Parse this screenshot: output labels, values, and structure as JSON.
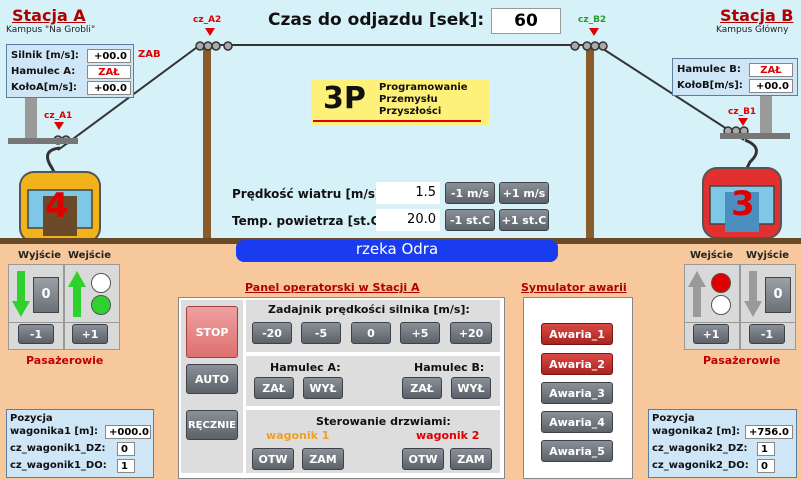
{
  "header": {
    "countdown_label": "Czas do odjazdu [sek]:",
    "countdown_value": "60"
  },
  "station_a": {
    "title": "Stacja A",
    "subtitle": "Kampus \"Na Grobli\"",
    "rows": [
      {
        "label": "Silnik [m/s]:",
        "value": "+00.0"
      },
      {
        "label": "Hamulec A:",
        "value": "ZAŁ"
      },
      {
        "label": "KołoA[m/s]:",
        "value": "+00.0"
      }
    ],
    "zab": "ZAB"
  },
  "station_b": {
    "title": "Stacja B",
    "subtitle": "Kampus Główny",
    "rows": [
      {
        "label": "Hamulec B:",
        "value": "ZAŁ"
      },
      {
        "label": "KołoB[m/s]:",
        "value": "+00.0"
      }
    ]
  },
  "sensors": {
    "a1": "cz_A1",
    "a2": "cz_A2",
    "b1": "cz_B1",
    "b2": "cz_B2"
  },
  "logo": {
    "big": "3P",
    "line1": "Programowanie",
    "line2": "Przemysłu",
    "line3": "Przyszłości"
  },
  "weather": {
    "wind_label": "Prędkość wiatru [m/s]:",
    "wind_value": "1.5",
    "wind_minus": "-1 m/s",
    "wind_plus": "+1 m/s",
    "temp_label": "Temp. powietrza [st.C]:",
    "temp_value": "20.0",
    "temp_minus": "-1 st.C",
    "temp_plus": "+1 st.C"
  },
  "river": "rzeka Odra",
  "gondolas": {
    "left_number": "4",
    "right_number": "3"
  },
  "passengers_left": {
    "exit_label": "Wyjście",
    "enter_label": "Wejście",
    "exit_count": "0",
    "minus": "-1",
    "plus": "+1",
    "caption": "Pasażerowie"
  },
  "passengers_right": {
    "enter_label": "Wejście",
    "exit_label": "Wyjście",
    "exit_count": "0",
    "plus": "+1",
    "minus": "-1",
    "caption": "Pasażerowie"
  },
  "operator": {
    "title": "Panel operatorski w Stacji A",
    "modes": {
      "stop": "STOP",
      "auto": "AUTO",
      "manual": "RĘCZNIE"
    },
    "speed_title": "Zadajnik prędkości silnika [m/s]:",
    "speeds": [
      "-20",
      "-5",
      "0",
      "+5",
      "+20"
    ],
    "brake_a": "Hamulec A:",
    "brake_b": "Hamulec B:",
    "on": "ZAŁ",
    "off": "WYŁ",
    "doors_title": "Sterowanie drzwiami:",
    "wagon1": "wagonik 1",
    "wagon2": "wagonik 2",
    "open": "OTW",
    "close": "ZAM"
  },
  "faults": {
    "title": "Symulator awarii",
    "items": [
      "Awaria_1",
      "Awaria_2",
      "Awaria_3",
      "Awaria_4",
      "Awaria_5"
    ]
  },
  "pos_left": {
    "label1": "Pozycja",
    "label2": "wagonika1 [m]:",
    "value": "+000.0",
    "dz_label": "cz_wagonik1_DZ:",
    "dz": "0",
    "do_label": "cz_wagonik1_DO:",
    "do": "1"
  },
  "pos_right": {
    "label1": "Pozycja",
    "label2": "wagonika2 [m]:",
    "value": "+756.0",
    "dz_label": "cz_wagonik2_DZ:",
    "dz": "1",
    "do_label": "cz_wagonik2_DO:",
    "do": "0"
  },
  "colors": {
    "accent_red": "#e00000",
    "sky": "#d7f1f8",
    "ground": "#f7c89c",
    "river": "#1a3cf0",
    "fault_active": "#b52a26"
  }
}
